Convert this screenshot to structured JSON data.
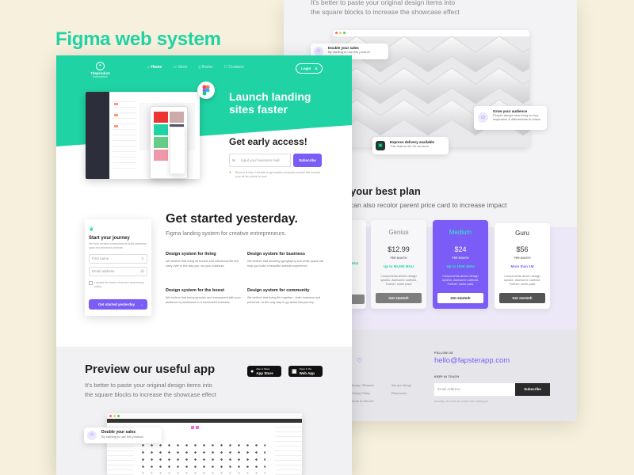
{
  "headline": "Figma web system",
  "back": {
    "top_text_line1": "It's better to paste your original design items into",
    "top_text_line2": "the square blocks to increase the showcase effect",
    "callout1": {
      "title": "Double your sales",
      "desc": "By starting to use this product"
    },
    "callout2": {
      "title": "Grow your audience",
      "desc": "People always searching for key inspiration & differentiate to follow"
    },
    "callout3": {
      "title": "Express delivery available",
      "desc": "This feature fits for services"
    },
    "plan_heading": "your best plan",
    "plan_sub": "can also recolor parent price card to increase impact",
    "plans": [
      {
        "name": "Genius",
        "price": "$12.99",
        "per": "PER MONTH",
        "limit": "Up to 50,000 MAU",
        "desc": "Components-driven design system. Awesome outlined. Further: some pack",
        "cta": "Get started!"
      },
      {
        "name": "Medium",
        "price": "$24",
        "per": "PER MONTH",
        "limit": "Up to 100K MAU",
        "desc": "Components-driven design system. Awesome outlined. Further: some pack",
        "cta": "Get started!"
      },
      {
        "name": "Guru",
        "price": "$56",
        "per": "PER MONTH",
        "limit": "More than 1M",
        "desc": "Components-driven design system. Awesome outlined. Further: some pack",
        "cta": "Get started!"
      }
    ],
    "first_plan_limit": "MAU",
    "follow_label": "FOLLOW US",
    "email": "hello@fapsterapp.com",
    "keep_label": "KEEP IN TOUCH",
    "email_placeholder": "Email Address",
    "subscribe": "Subscribe",
    "footer_links_col1": [
      "Library / Returns",
      "Privacy Policy",
      "Terms of Service"
    ],
    "footer_links_col2": [
      "We are hiring!",
      "Resources"
    ],
    "copyright": "Actually, we invite all cookies like eating you"
  },
  "front": {
    "logo_name": "Theproduct",
    "logo_sub": "Subscription",
    "nav": [
      "Home",
      "Store",
      "Books",
      "Contacts"
    ],
    "login": "Login",
    "hero_title_l1": "Launch landing",
    "hero_title_l2": "sites faster",
    "early_access": "Get early access!",
    "email_placeholder": "Input your business mail",
    "subscribe": "Subscribe",
    "hint": "Bunsen is here. Hint title to get market showcase accent! We commit your all the prices for you!",
    "journey_title": "Start your journey",
    "journey_desc": "We help creative entrepreneurs build awesome apps and released products",
    "first_name_ph": "First name",
    "email_ph": "Email address",
    "terms": "I accept the terms of service and privacy policy",
    "journey_cta": "Get started yesterday",
    "section_title": "Get started yesterday.",
    "section_sub": "Figma landing system for creative entrepreneurs.",
    "features": [
      {
        "title": "Design system for living",
        "desc": "We believe that living an honest and intentional life will carry over to the way you run your business."
      },
      {
        "title": "Design system for business",
        "desc": "We believe that amazing typography and white space will help you build a beautiful website experience."
      },
      {
        "title": "Design system for the boost",
        "desc": "We believe that being genuine and transparent with your audience is paramount to a successful business."
      },
      {
        "title": "Design system for community",
        "desc": "We believe that doing life together—both business and personal—is the only way to go about this journey."
      }
    ],
    "preview_title": "Preview our useful app",
    "preview_l1": "It's better to paste your original design items into",
    "preview_l2": "the square blocks to increase the showcase effect",
    "appstore_small": "Also in Store",
    "appstore": "App Store",
    "webapp_small": "Open in the",
    "webapp": "Web App",
    "callout": {
      "title": "Double your sales",
      "desc": "By starting to use this product"
    }
  },
  "colors": {
    "green": "#1fd3a4",
    "purple": "#7b5cf6",
    "bg": "#f6f0dc"
  }
}
